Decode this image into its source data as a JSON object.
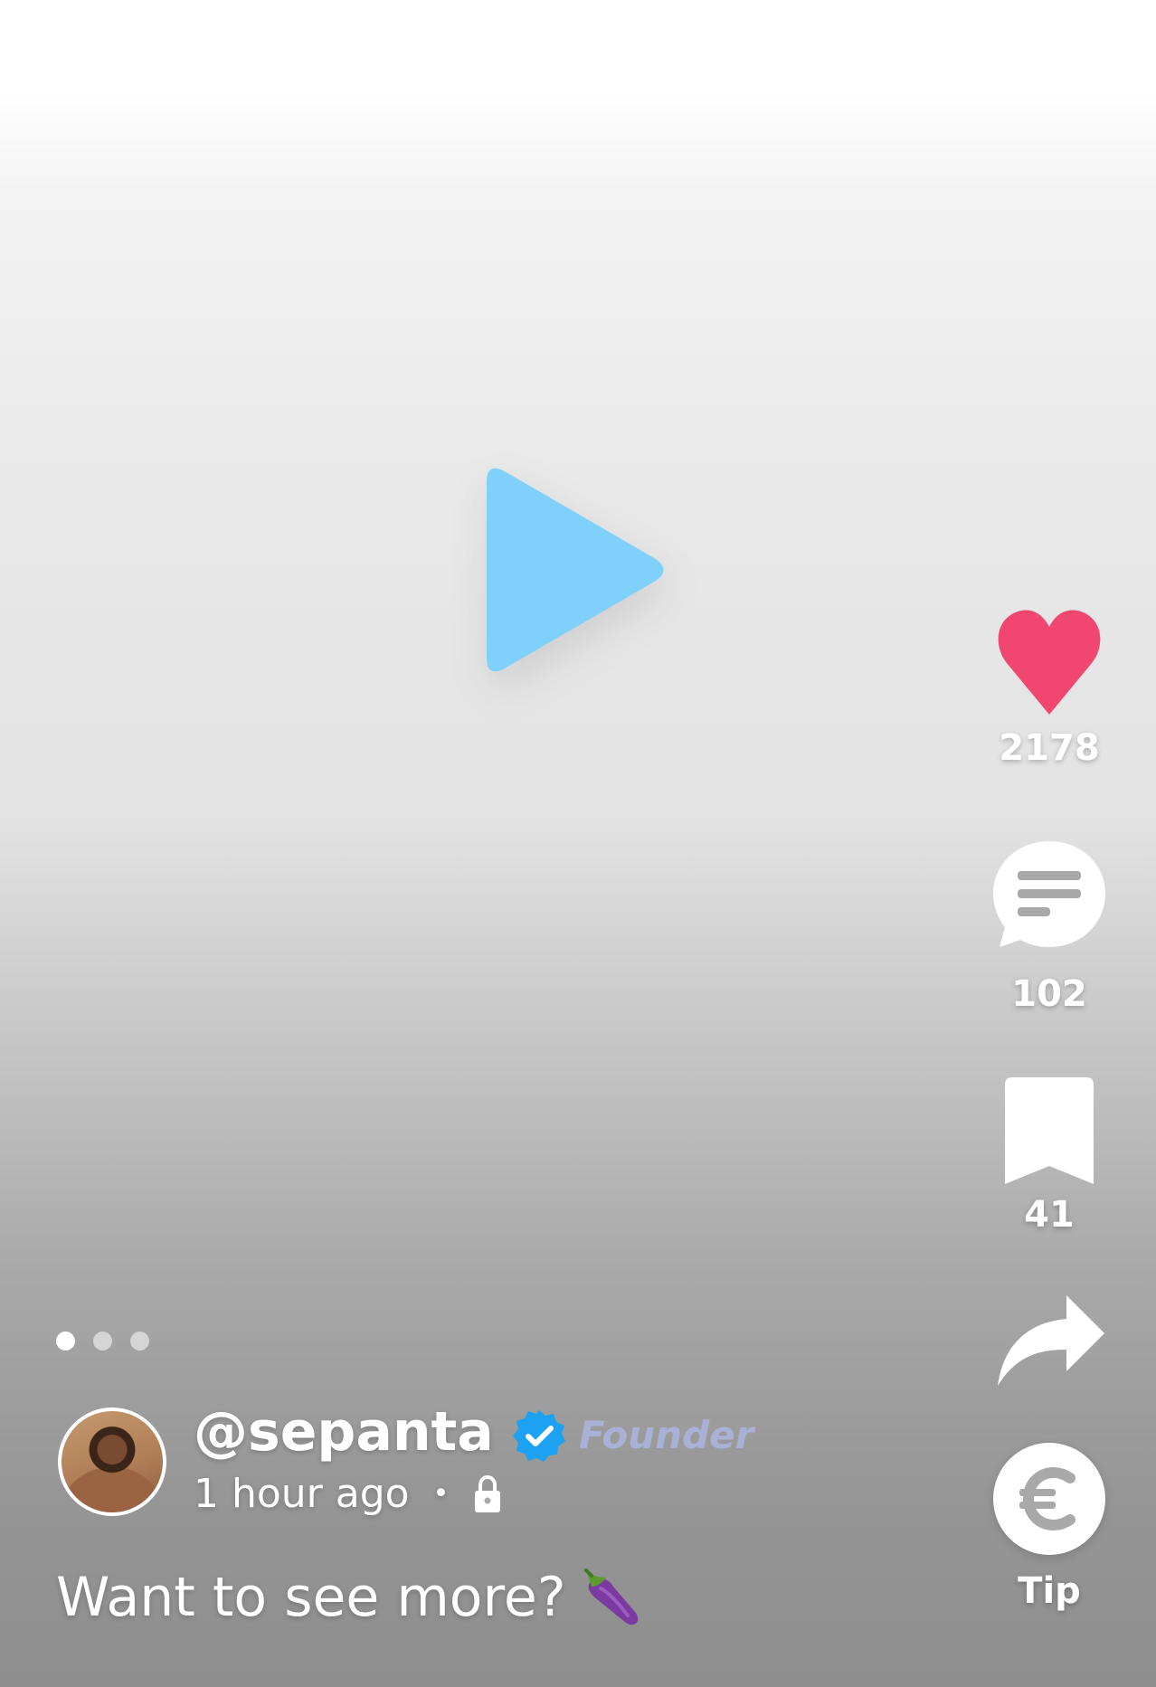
{
  "post": {
    "username": "@sepanta",
    "role": "Founder",
    "time": "1 hour ago",
    "separator": "•",
    "caption": "Want to see more?",
    "caption_emoji": "eggplant-icon",
    "media_pages": 3,
    "current_page": 1
  },
  "actions": {
    "likes": "2178",
    "comments": "102",
    "bookmarks": "41",
    "tip_label": "Tip"
  },
  "icons": {
    "play": "play-icon",
    "like": "heart-icon",
    "comment": "comment-icon",
    "bookmark": "bookmark-icon",
    "share": "share-icon",
    "tip": "euro-icon",
    "verified": "verified-badge-icon",
    "lock": "lock-icon"
  },
  "colors": {
    "play": "#7fd1fc",
    "heart": "#f0466f",
    "verified": "#1da1f2",
    "role": "#a9b2d6",
    "eggplant": "#7b3aa0"
  }
}
